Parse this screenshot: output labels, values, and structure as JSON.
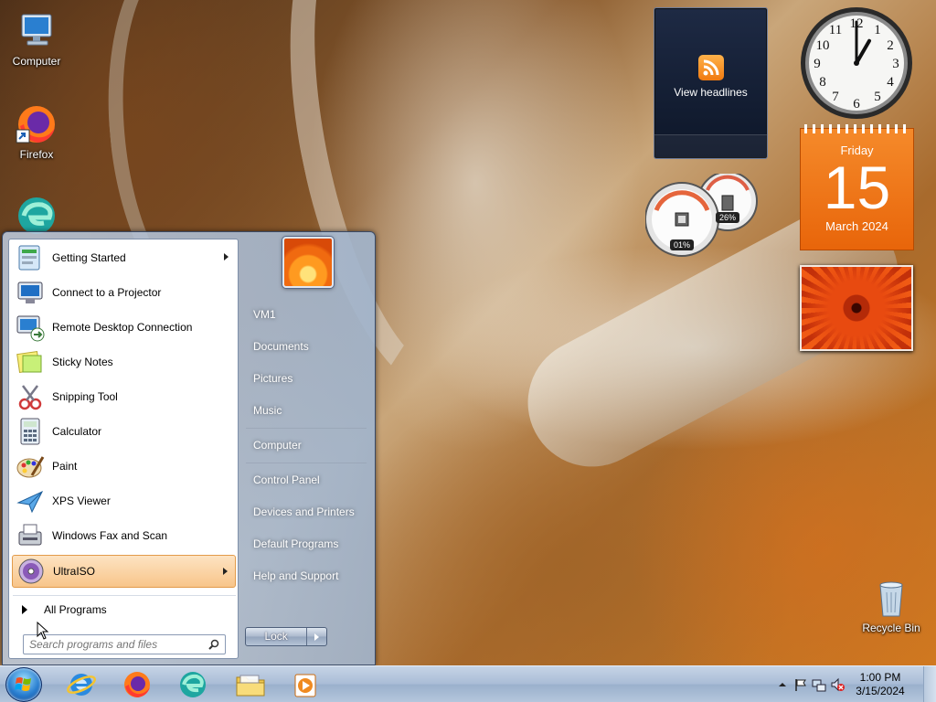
{
  "desktop": {
    "icons": [
      {
        "label": "Computer",
        "icon": "computer-icon"
      },
      {
        "label": "Firefox",
        "icon": "firefox-icon"
      },
      {
        "label": "",
        "icon": "edge-icon"
      },
      {
        "label": "Recycle Bin",
        "icon": "recycle-bin-icon"
      }
    ]
  },
  "gadgets": {
    "rss": {
      "label": "View headlines"
    },
    "clock": {
      "hour": 1,
      "minute": 0
    },
    "calendar": {
      "day_of_week": "Friday",
      "day": "15",
      "month_year": "March 2024"
    },
    "cpu_meter": {
      "cpu": "01%",
      "memory": "26%"
    },
    "slideshow": {
      "subject": "orange flower"
    }
  },
  "start_menu": {
    "programs": [
      {
        "label": "Getting Started",
        "icon": "getting-started-icon",
        "has_submenu": true
      },
      {
        "label": "Connect to a Projector",
        "icon": "projector-icon",
        "has_submenu": false
      },
      {
        "label": "Remote Desktop Connection",
        "icon": "remote-desktop-icon",
        "has_submenu": false
      },
      {
        "label": "Sticky Notes",
        "icon": "sticky-notes-icon",
        "has_submenu": false
      },
      {
        "label": "Snipping Tool",
        "icon": "snipping-tool-icon",
        "has_submenu": false
      },
      {
        "label": "Calculator",
        "icon": "calculator-icon",
        "has_submenu": false
      },
      {
        "label": "Paint",
        "icon": "paint-icon",
        "has_submenu": false
      },
      {
        "label": "XPS Viewer",
        "icon": "xps-viewer-icon",
        "has_submenu": false
      },
      {
        "label": "Windows Fax and Scan",
        "icon": "fax-scan-icon",
        "has_submenu": false
      },
      {
        "label": "UltraISO",
        "icon": "ultraiso-icon",
        "has_submenu": true,
        "highlighted": true
      }
    ],
    "all_programs": "All Programs",
    "search": {
      "placeholder": "Search programs and files",
      "value": ""
    },
    "right_items": [
      {
        "label": "VM1"
      },
      {
        "label": "Documents"
      },
      {
        "label": "Pictures"
      },
      {
        "label": "Music"
      },
      {
        "label": "Computer"
      },
      {
        "label": "Control Panel"
      },
      {
        "label": "Devices and Printers"
      },
      {
        "label": "Default Programs"
      },
      {
        "label": "Help and Support"
      }
    ],
    "lock_label": "Lock"
  },
  "taskbar": {
    "pinned": [
      {
        "icon": "internet-explorer-icon"
      },
      {
        "icon": "firefox-icon"
      },
      {
        "icon": "edge-icon"
      },
      {
        "icon": "file-explorer-icon"
      },
      {
        "icon": "media-player-icon"
      }
    ],
    "clock": {
      "time": "1:00 PM",
      "date": "3/15/2024"
    }
  },
  "colors": {
    "calendar_orange": "#ef7318",
    "highlight": "#f8c58a",
    "taskbar": "#a9bcd6"
  }
}
